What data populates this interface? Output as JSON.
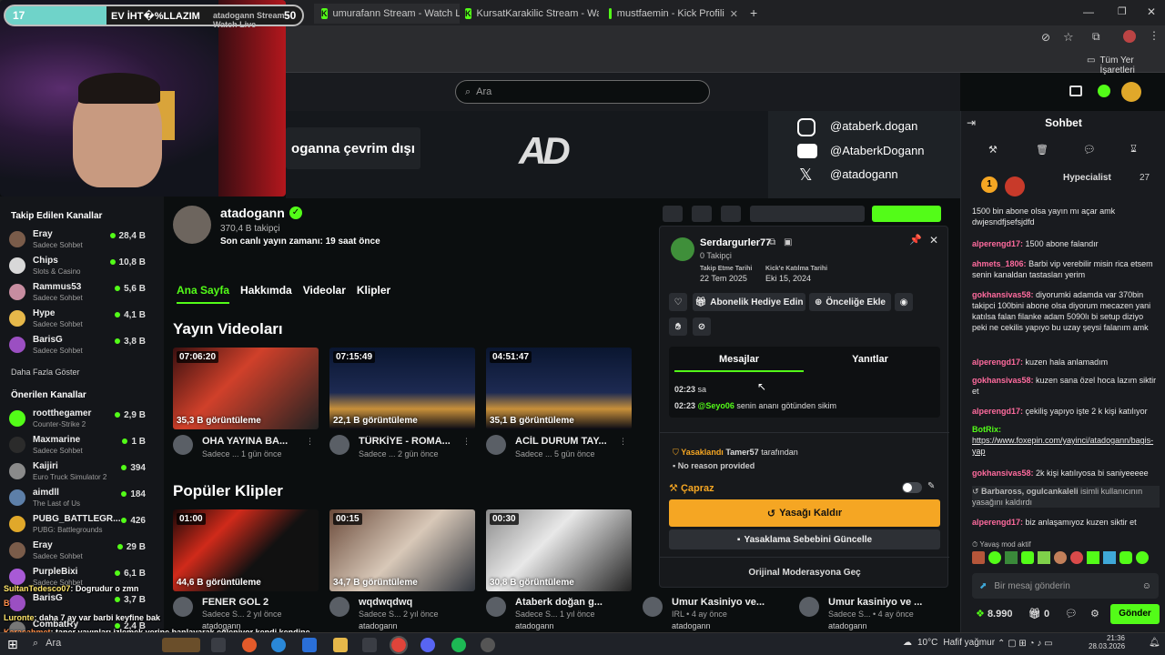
{
  "browser": {
    "tabs": [
      {
        "label": "EV İHT�%LLAZIM",
        "counter_left": "17",
        "counter_right": "50"
      },
      {
        "label": "atadogann Stream - Watch Live"
      },
      {
        "label": "umurafann Stream - Watch Live"
      },
      {
        "label": "KursatKarakilic Stream - Watch"
      },
      {
        "label": "mustfaemin - Kick Profili"
      }
    ],
    "bookmarks_label": "Tüm Yer İşaretleri"
  },
  "search": {
    "placeholder": "Ara"
  },
  "banner": {
    "offline_text": "oganna çevrim dışı",
    "socials": [
      "@ataberk.dogan",
      "@AtaberkDogann",
      "@atadogann"
    ]
  },
  "sidebar": {
    "followed_title": "Takip Edilen Kanallar",
    "followed": [
      {
        "name": "Eray",
        "sub": "Sadece Sohbet",
        "viewers": "28,4 B",
        "color": "#7a5c4a"
      },
      {
        "name": "Chips",
        "sub": "Slots & Casino",
        "viewers": "10,8 B",
        "color": "#d8d8d8"
      },
      {
        "name": "Rammus53",
        "sub": "Sadece Sohbet",
        "viewers": "5,6 B",
        "color": "#c78da0"
      },
      {
        "name": "Hype",
        "sub": "Sadece Sohbet",
        "viewers": "4,1 B",
        "color": "#e6b84a"
      },
      {
        "name": "BarisG",
        "sub": "Sadece Sohbet",
        "viewers": "3,8 B",
        "color": "#9b4fc2"
      }
    ],
    "show_more": "Daha Fazla Göster",
    "recommended_title": "Önerilen Kanallar",
    "recommended": [
      {
        "name": "rootthegamer",
        "sub": "Counter-Strike 2",
        "viewers": "2,9 B",
        "color": "#53fc18"
      },
      {
        "name": "Maxmarine",
        "sub": "Sadece Sohbet",
        "viewers": "1 B",
        "color": "#2b2b2b"
      },
      {
        "name": "Kaijiri",
        "sub": "Euro Truck Simulator 2",
        "viewers": "394",
        "color": "#8a8a8a"
      },
      {
        "name": "aimdll",
        "sub": "The Last of Us",
        "viewers": "184",
        "color": "#5d7fa8"
      },
      {
        "name": "PUBG_BATTLEGR...",
        "sub": "PUBG: Battlegrounds",
        "viewers": "426",
        "color": "#e0a82a"
      },
      {
        "name": "Eray",
        "sub": "Sadece Sohbet",
        "viewers": "29 B",
        "color": "#7a5c4a"
      },
      {
        "name": "PurpleBixi",
        "sub": "Sadece Sohbet",
        "viewers": "6,1 B",
        "color": "#a85ad6"
      },
      {
        "name": "BarisG",
        "sub": "",
        "viewers": "3,7 B",
        "color": "#9b4fc2"
      },
      {
        "name": "CombatRy",
        "sub": "",
        "viewers": "2,4 B",
        "color": "#777"
      }
    ]
  },
  "profile": {
    "name": "atadogann",
    "followers": "370,4 B takipçi",
    "last_live": "Son canlı yayın zamanı: 19 saat önce",
    "tabs": [
      "Ana Sayfa",
      "Hakkımda",
      "Videolar",
      "Klipler"
    ]
  },
  "videos_title": "Yayın Videoları",
  "videos": [
    {
      "duration": "07:06:20",
      "views": "35,3 B görüntüleme",
      "title": "OHA YAYINA BA...",
      "meta": "Sadece ... 1 gün önce"
    },
    {
      "duration": "07:15:49",
      "views": "22,1 B görüntüleme",
      "title": "TÜRKİYE - ROMA...",
      "meta": "Sadece ... 2 gün önce"
    },
    {
      "duration": "04:51:47",
      "views": "35,1 B görüntüleme",
      "title": "ACİL DURUM TAY...",
      "meta": "Sadece ... 5 gün önce"
    }
  ],
  "clips_title": "Popüler Klipler",
  "clips": [
    {
      "duration": "01:00",
      "views": "44,6 B görüntüleme",
      "title": "FENER GOL 2",
      "meta": "Sadece S... 2 yıl önce",
      "channel": "atadogann"
    },
    {
      "duration": "00:15",
      "views": "34,7 B görüntüleme",
      "title": "wqdwqdwq",
      "meta": "Sadece S... 2 yıl önce",
      "channel": "atadogann"
    },
    {
      "duration": "00:30",
      "views": "30,8 B görüntüleme",
      "title": "Ataberk doğan g...",
      "meta": "Sadece S... 1 yıl önce",
      "channel": "atadogann"
    },
    {
      "title": "Umur Kasiniyo ve...",
      "meta": "IRL • 4 ay önce",
      "channel": "atadogann"
    },
    {
      "title": "Umur kasiniyo ve ...",
      "meta": "Sadece S... • 4 ay önce",
      "channel": "atadogann"
    }
  ],
  "popup": {
    "username": "Serdargurler77",
    "followers": "0 Takipçi",
    "follow_date_label": "Takip Etme Tarihi",
    "follow_date": "22 Tem 2025",
    "join_label": "Kick'e Katılma Tarihi",
    "join_date": "Eki 15, 2024",
    "gift_label": "Abonelik Hediye Edin",
    "priority_label": "Önceliğe Ekle",
    "tab_messages": "Mesajlar",
    "tab_replies": "Yanıtlar",
    "messages": [
      {
        "time": "02:23",
        "text": "sa",
        "mention": ""
      },
      {
        "time": "02:23",
        "mention": "@Seyo06",
        "text": "senin ananı götünden sikim"
      }
    ],
    "banned_label": "Yasaklandı",
    "banned_by": "Tamer57",
    "banned_suffix": "tarafından",
    "reason": "No reason provided",
    "cross_label": "Çapraz",
    "unban_label": "Yasağı Kaldır",
    "update_label": "Yasaklama Sebebini Güncelle",
    "mod_label": "Orijinal Moderasyona Geç"
  },
  "chat": {
    "title": "Sohbet",
    "top_user": "Hypecialist",
    "top_count": "27",
    "messages": [
      {
        "user": "",
        "text": "1500 bin abone olsa yayın mı açar amk dwjesndfjsefsjdfd",
        "color": "#ff6b9e"
      },
      {
        "user": "alperengd17:",
        "text": "1500 abone falandır",
        "color": "#ff6b9e"
      },
      {
        "user": "ahmets_1806:",
        "text": "Barbi vip verebilir misin rica etsem senin kanaldan tastasları yerim",
        "color": "#ff6b9e"
      },
      {
        "user": "gokhansivas58:",
        "text": "diyorumki adamda var 370bin takipci 100bini abone olsa diyorum mecazen yani katılsa falan filanke adam 5090lı bi setup diziyo peki ne cekilis yapıyo bu uzay şeysi falanım amk",
        "color": "#ff6b9e"
      },
      {
        "user": "alperengd17:",
        "text": "kuzen hala anlamadım",
        "color": "#ff6b9e"
      },
      {
        "user": "gokhansivas58:",
        "text": "kuzen sana özel hoca lazım siktir et",
        "color": "#ff6b9e"
      },
      {
        "user": "alperengd17:",
        "text": "çekiliş yapıyo işte 2 k kişi katılıyor",
        "color": "#ff6b9e"
      },
      {
        "user": "BotRix:",
        "text": "https://www.foxepin.com/yayinci/atadogann/bagis-yap",
        "color": "#53fc18"
      },
      {
        "user": "gokhansivas58:",
        "text": "2k kişi katılıyosa bi saniyeeeee",
        "color": "#ff6b9e"
      },
      {
        "user": "Barbaross, ogulcankaleli",
        "text": "isimli kullanıcının yasağını kaldırdı",
        "color": "#bbbbbb"
      },
      {
        "user": "alperengd17:",
        "text": "biz anlaşamıyoz kuzen siktir et",
        "color": "#ff6b9e"
      }
    ],
    "slow_mode": "Yavaş mod aktif",
    "input_placeholder": "Bir mesaj gönderin",
    "points": "8.990",
    "gift_count": "0",
    "send_label": "Gönder"
  },
  "overlay_chat": [
    {
      "user": "SultanTedesco07",
      "text": ": Dogrudur o zmn"
    },
    {
      "user": "B",
      "text": ""
    },
    {
      "user": "Luronte",
      "text": ": daha 7 ay var barbi keyfine bak"
    },
    {
      "user": "Karacahmet",
      "text": ": taner yayınları izlemek yerine banlayarak eğleniyor kendi kendine"
    }
  ],
  "taskbar": {
    "search_label": "Ara",
    "weather": "10°C",
    "weather_text": "Hafif yağmur",
    "time": "21:36",
    "date": "28.03.2026"
  },
  "colors": {
    "accent": "#53fc18",
    "amber": "#f5a623",
    "bg": "#0b0e0f"
  }
}
